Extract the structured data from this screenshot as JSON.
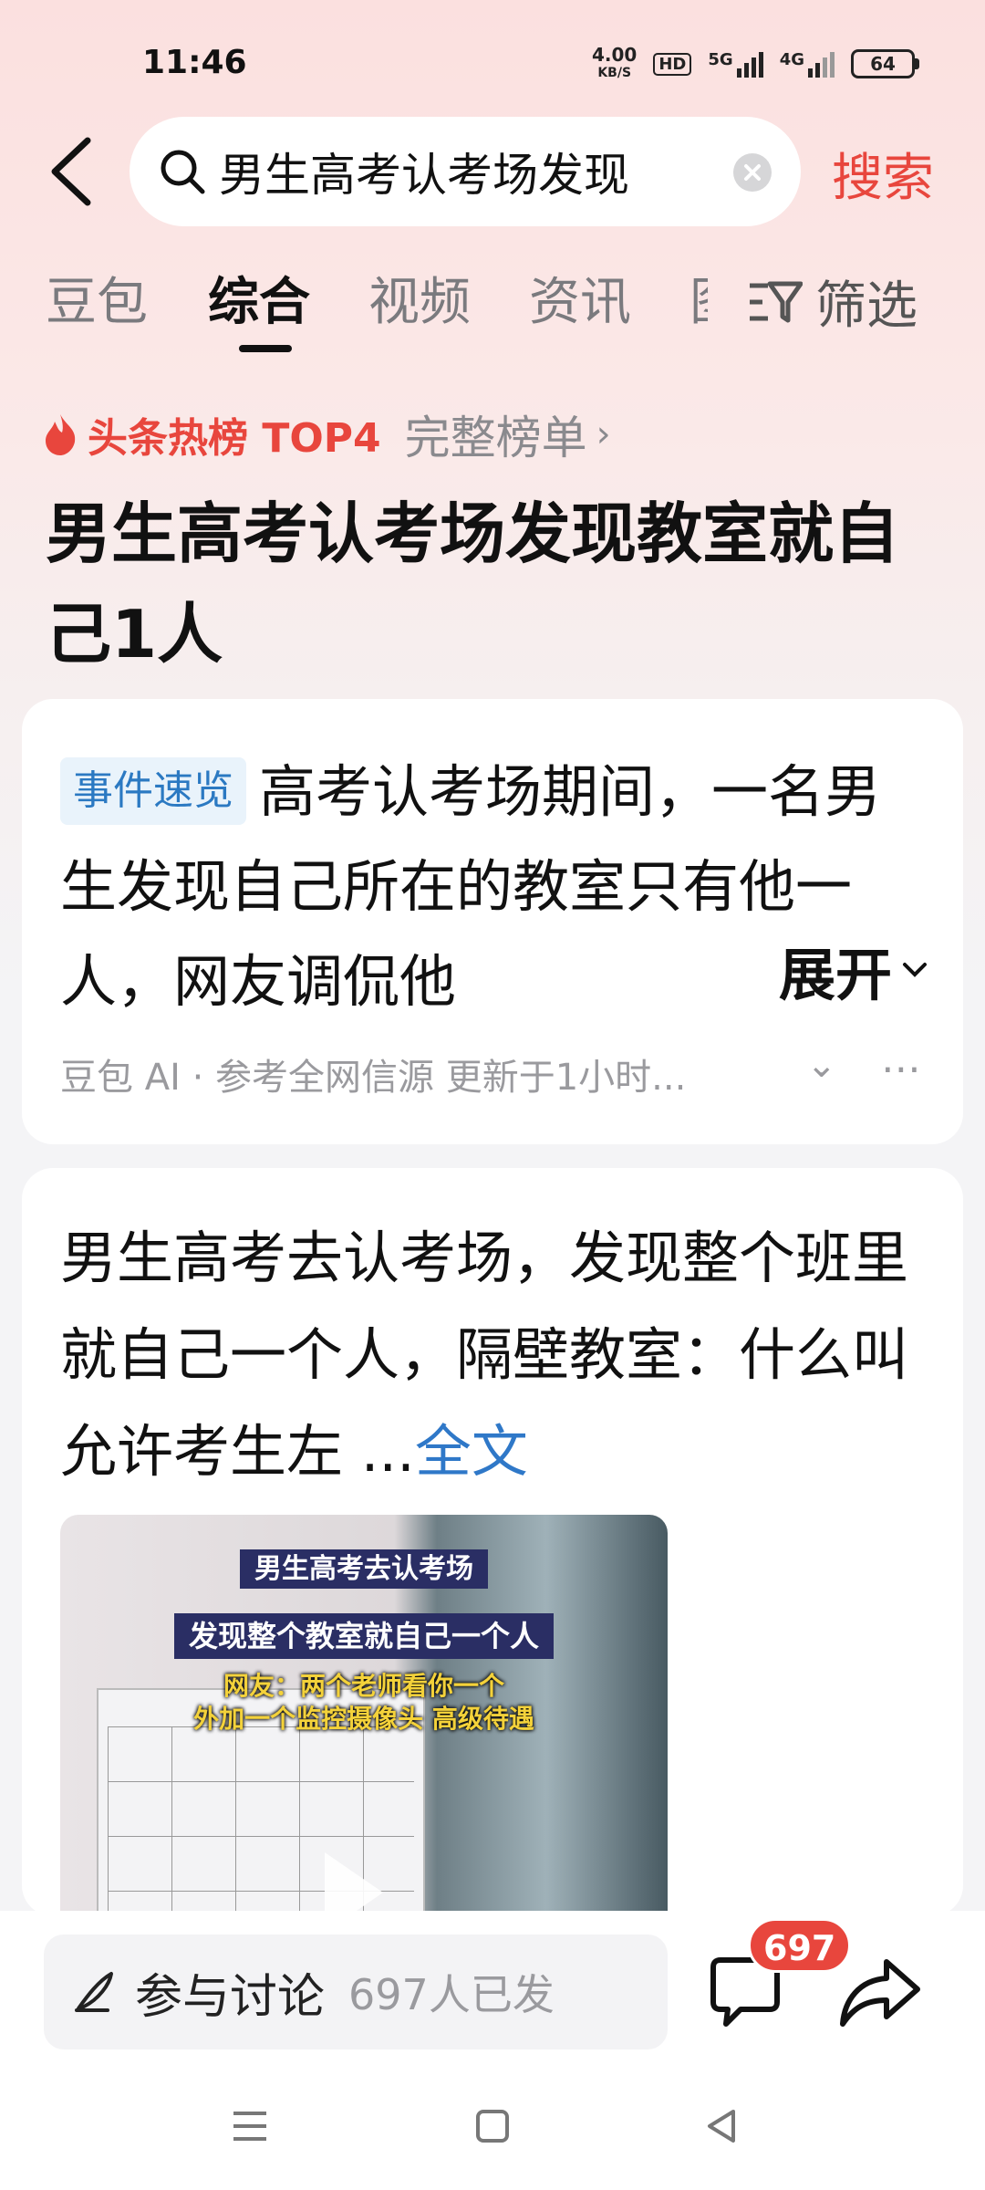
{
  "status_bar": {
    "time": "11:46",
    "speed_value": "4.00",
    "speed_unit": "KB/S",
    "hd": "HD",
    "net1": "5G",
    "net2": "4G",
    "battery": "64"
  },
  "search": {
    "query": "男生高考认考场发现",
    "button_label": "搜索"
  },
  "tabs": [
    "豆包",
    "综合",
    "视频",
    "资讯",
    "图"
  ],
  "active_tab": "综合",
  "filter_label": "筛选",
  "hot_list": {
    "label": "头条热榜 TOP4",
    "full_list": "完整榜单"
  },
  "main_title": "男生高考认考场发现教室就自己1人",
  "summary_card": {
    "tag": "事件速览",
    "text": "高考认考场期间，一名男生发现自己所在的教室只有他一人，网友调侃他",
    "expand_label": "展开",
    "source": "豆包 AI · 参考全网信源 更新于1小时..."
  },
  "article_card": {
    "text": "男生高考去认考场，发现整个班里就自己一个人，隔壁教室：什么叫允许考生左 ...",
    "full_text_label": "全文",
    "video_captions": {
      "line1": "男生高考去认考场",
      "line2": "发现整个教室就自己一个人",
      "line3a": "网友：两个老师看你一个",
      "line3b": "外加一个监控摄像头 高级待遇"
    }
  },
  "bottom_bar": {
    "discuss_label": "参与讨论",
    "discuss_count": "697人已发",
    "comment_badge": "697"
  },
  "colors": {
    "accent_red": "#e8463d",
    "link_blue": "#2f78c8",
    "tag_blue": "#2b79c2"
  }
}
